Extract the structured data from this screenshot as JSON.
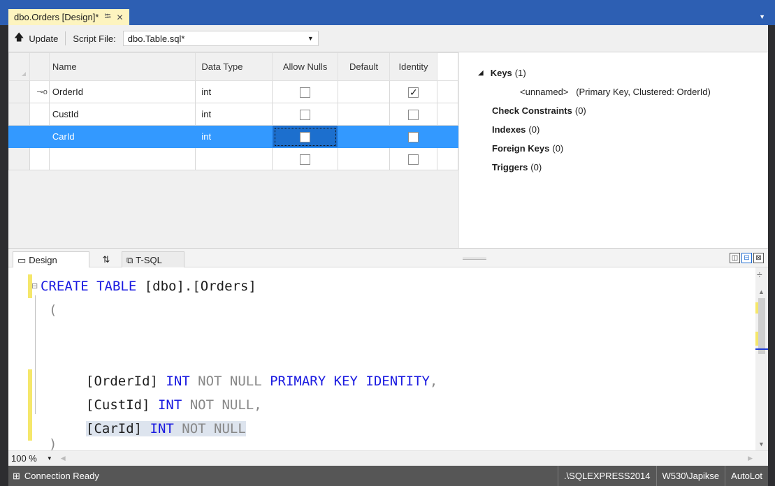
{
  "tab": {
    "title": "dbo.Orders [Design]*",
    "pin": "⭾",
    "close": "✕"
  },
  "toolbar": {
    "update_label": "Update",
    "script_file_label": "Script File:",
    "script_file_value": "dbo.Table.sql*"
  },
  "grid": {
    "headers": {
      "name": "Name",
      "data_type": "Data Type",
      "allow_nulls": "Allow Nulls",
      "default": "Default",
      "identity": "Identity"
    },
    "rows": [
      {
        "name": "OrderId",
        "data_type": "int",
        "allow_nulls": false,
        "identity": true,
        "primary_key": true,
        "selected": false
      },
      {
        "name": "CustId",
        "data_type": "int",
        "allow_nulls": false,
        "identity": false,
        "primary_key": false,
        "selected": false
      },
      {
        "name": "CarId",
        "data_type": "int",
        "allow_nulls": false,
        "identity": false,
        "primary_key": false,
        "selected": true
      },
      {
        "name": "",
        "data_type": "",
        "allow_nulls": false,
        "identity": false,
        "primary_key": false,
        "selected": false
      }
    ]
  },
  "keys_panel": {
    "keys_label": "Keys",
    "keys_count": "(1)",
    "key_item": "<unnamed>   (Primary Key, Clustered: OrderId)",
    "check_label": "Check Constraints",
    "check_count": "(0)",
    "indexes_label": "Indexes",
    "indexes_count": "(0)",
    "foreign_label": "Foreign Keys",
    "foreign_count": "(0)",
    "triggers_label": "Triggers",
    "triggers_count": "(0)"
  },
  "pane_tabs": {
    "design": "Design",
    "swap": "⇅",
    "tsql": "T-SQL"
  },
  "code": {
    "l1_kw": "CREATE TABLE",
    "l1_id": " [dbo].[Orders]",
    "l2": "(",
    "l3_id": "[OrderId]",
    "l3_kw1": " INT",
    "l3_gr": " NOT NULL",
    "l3_kw2": " PRIMARY KEY IDENTITY",
    "l3_end": ",",
    "l4_id": "[CustId]",
    "l4_kw": " INT",
    "l4_gr": " NOT NULL",
    "l4_end": ",",
    "l5_id": "[CarId]",
    "l5_kw": " INT",
    "l5_gr": " NOT NULL",
    "l6": ")"
  },
  "zoom": {
    "value": "100 %"
  },
  "status": {
    "connection": "Connection Ready",
    "server": ".\\SQLEXPRESS2014",
    "user": "W530\\Japikse",
    "database": "AutoLot"
  },
  "colors": {
    "accent": "#2d5fb3",
    "selection": "#3399ff",
    "keyword": "#1a1ae0",
    "status_bar": "#565656",
    "change_marker": "#f5e76b"
  }
}
